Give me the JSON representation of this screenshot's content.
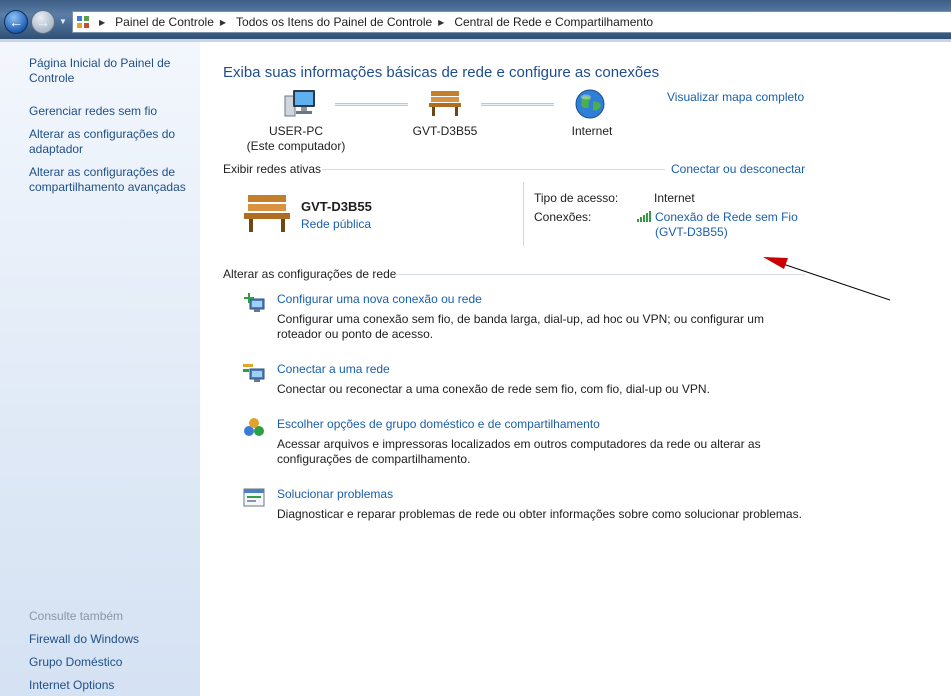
{
  "breadcrumb": [
    "Painel de Controle",
    "Todos os Itens do Painel de Controle",
    "Central de Rede e Compartilhamento"
  ],
  "sidebar": {
    "links": [
      {
        "label": "Página Inicial do Painel de Controle"
      },
      {
        "label": "Gerenciar redes sem fio"
      },
      {
        "label": "Alterar as configurações do adaptador"
      },
      {
        "label": "Alterar as configurações de compartilhamento avançadas"
      }
    ],
    "see_also_caption": "Consulte também",
    "see_also": [
      {
        "label": "Firewall do Windows"
      },
      {
        "label": "Grupo Doméstico"
      },
      {
        "label": "Internet Options"
      }
    ]
  },
  "main": {
    "title": "Exiba suas informações básicas de rede e configure as conexões",
    "view_full_map": "Visualizar mapa completo",
    "map": {
      "computer_name": "USER-PC",
      "computer_sub": "(Este computador)",
      "network_name": "GVT-D3B55",
      "internet": "Internet"
    },
    "active_networks_label": "Exibir redes ativas",
    "connect_disconnect": "Conectar ou desconectar",
    "active_network": {
      "name": "GVT-D3B55",
      "type_link": "Rede pública",
      "access_type_label": "Tipo de acesso:",
      "access_type_value": "Internet",
      "connections_label": "Conexões:",
      "connection_line1": "Conexão de Rede sem Fio",
      "connection_line2": "(GVT-D3B55)"
    },
    "change_settings_label": "Alterar as configurações de rede",
    "tasks": [
      {
        "title": "Configurar uma nova conexão ou rede",
        "desc": "Configurar uma conexão sem fio, de banda larga, dial-up, ad hoc ou VPN; ou configurar um roteador ou ponto de acesso."
      },
      {
        "title": "Conectar a uma rede",
        "desc": "Conectar ou reconectar a uma conexão de rede sem fio, com fio, dial-up ou VPN."
      },
      {
        "title": "Escolher opções de grupo doméstico e de compartilhamento",
        "desc": "Acessar arquivos e impressoras localizados em outros computadores da rede ou alterar as configurações de compartilhamento."
      },
      {
        "title": "Solucionar problemas",
        "desc": "Diagnosticar e reparar problemas de rede ou obter informações sobre como solucionar problemas."
      }
    ]
  },
  "colors": {
    "link": "#1a5fad",
    "heading": "#1e4d91",
    "sidebar_bg": "#dfe9f6",
    "annotation_arrow": "#cc0000"
  }
}
